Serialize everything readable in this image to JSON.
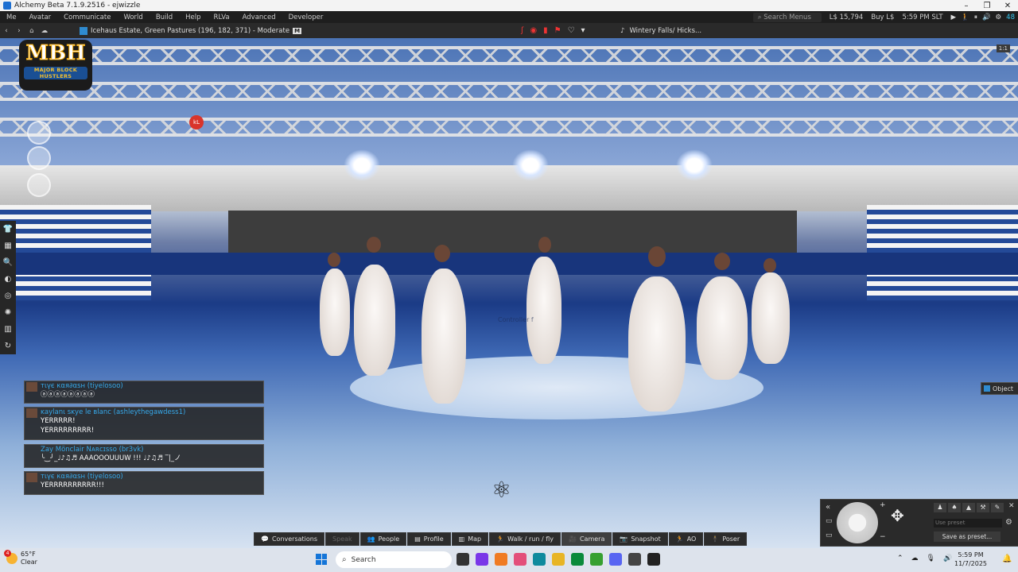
{
  "window": {
    "title": "Alchemy Beta 7.1.9.2516 - ejwizzle",
    "min": "–",
    "max": "❐",
    "close": "✕"
  },
  "menu": {
    "items": [
      "Me",
      "Avatar",
      "Communicate",
      "World",
      "Build",
      "Help",
      "RLVa",
      "Advanced",
      "Developer"
    ],
    "search_placeholder": "Search Menus",
    "balance": "L$ 15,794",
    "buy": "Buy L$",
    "time": "5:59 PM SLT",
    "fps": "48"
  },
  "nav": {
    "location": "Icehaus Estate, Green Pastures (196, 182, 371) - Moderate",
    "maturity": "M",
    "music": "Wintery Falls/ Hicks..."
  },
  "scene": {
    "logo_big": "MBH",
    "logo_small": "MAJOR BLOCK HUSTLERS",
    "red_button": "kL",
    "corner_badge": "1:1",
    "watermark": "Controller f"
  },
  "left_toolbar": [
    "👕",
    "▦",
    "🔍",
    "◐",
    "◎",
    "✺",
    "▥",
    "↻"
  ],
  "chat": [
    {
      "name": "тιүє кαя∂αѕн (tiyelosoo)",
      "lines": [
        "ⓐⓐⓐⓐⓐⓐⓐⓐ"
      ]
    },
    {
      "name": "ĸaylanι ѕĸye le вlanc (ashleythegawdess1)",
      "lines": [
        "YERRRRR!",
        "YERRRRRRRRR!"
      ]
    },
    {
      "name": "Zay Mönclair Nᴀʀᴄɪssᴏ (br3vk)",
      "lines": [
        "╰‿╯_♩♪♫♬ AAAOOOUUUW !!! ♩♪♫♬ ‾|_ノ"
      ]
    },
    {
      "name": "тιүє кαя∂αѕн (tiyelosoo)",
      "lines": [
        "YERRRRRRRRRR!!!"
      ]
    }
  ],
  "object_button": "Object",
  "movement": {
    "pose_buttons": [
      "♟",
      "♠",
      "▲",
      "⚒",
      "✎"
    ],
    "preset_placeholder": "Use preset",
    "save_preset": "Save as preset..."
  },
  "bottom_toolbar": [
    {
      "icon": "💬",
      "label": "Conversations",
      "state": "normal"
    },
    {
      "icon": "",
      "label": "Speak",
      "state": "disabled"
    },
    {
      "icon": "👥",
      "label": "People",
      "state": "normal"
    },
    {
      "icon": "▤",
      "label": "Profile",
      "state": "normal"
    },
    {
      "icon": "▥",
      "label": "Map",
      "state": "normal"
    },
    {
      "icon": "🏃",
      "label": "Walk / run / fly",
      "state": "normal"
    },
    {
      "icon": "🎥",
      "label": "Camera",
      "state": "active"
    },
    {
      "icon": "📷",
      "label": "Snapshot",
      "state": "normal"
    },
    {
      "icon": "🏃",
      "label": "AO",
      "state": "normal"
    },
    {
      "icon": "🕴",
      "label": "Poser",
      "state": "normal"
    }
  ],
  "taskbar": {
    "temp": "65°F",
    "condition": "Clear",
    "badge": "4",
    "search": "Search",
    "app_colors": [
      "#333333",
      "#7a37e8",
      "#f07b22",
      "#e34f7a",
      "#0f8a9d",
      "#e8b524",
      "#0a8a3a",
      "#36a030",
      "#5865f2",
      "#444444",
      "#222222"
    ],
    "time": "5:59 PM",
    "date": "11/7/2025"
  },
  "colors": {
    "accent": "#36a8e8",
    "chat_bg": "#232323",
    "toolbar_bg": "#2c2c2c"
  }
}
